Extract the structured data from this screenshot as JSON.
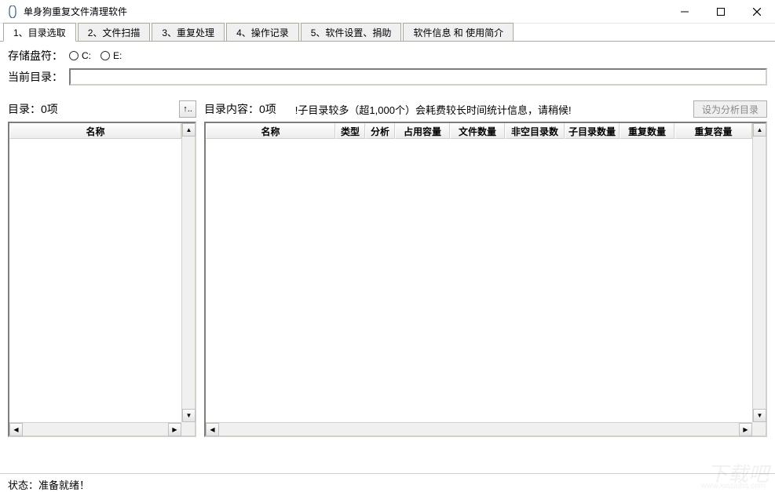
{
  "window": {
    "title": "单身狗重复文件清理软件"
  },
  "tabs": [
    {
      "label": "1、目录选取"
    },
    {
      "label": "2、文件扫描"
    },
    {
      "label": "3、重复处理"
    },
    {
      "label": "4、操作记录"
    },
    {
      "label": "5、软件设置、捐助"
    },
    {
      "label": "软件信息 和 使用简介"
    }
  ],
  "storage": {
    "label": "存储盘符：",
    "options": [
      {
        "letter": "C:"
      },
      {
        "letter": "E:"
      }
    ]
  },
  "current_dir": {
    "label": "当前目录：",
    "value": ""
  },
  "left_panel": {
    "count_label": "目录：0项",
    "up_button": "↑..",
    "columns": [
      "名称"
    ]
  },
  "right_panel": {
    "count_label": "目录内容：0项",
    "hint": "!子目录较多（超1,000个）会耗费较长时间统计信息，请稍候!",
    "set_btn": "设为分析目录",
    "columns": [
      "名称",
      "类型",
      "分析",
      "占用容量",
      "文件数量",
      "非空目录数",
      "子目录数量",
      "重复数量",
      "重复容量"
    ]
  },
  "status": {
    "text": "状态：准备就绪！"
  },
  "watermark": {
    "main": "下载吧",
    "sub": "www.xiazaiba.com"
  }
}
